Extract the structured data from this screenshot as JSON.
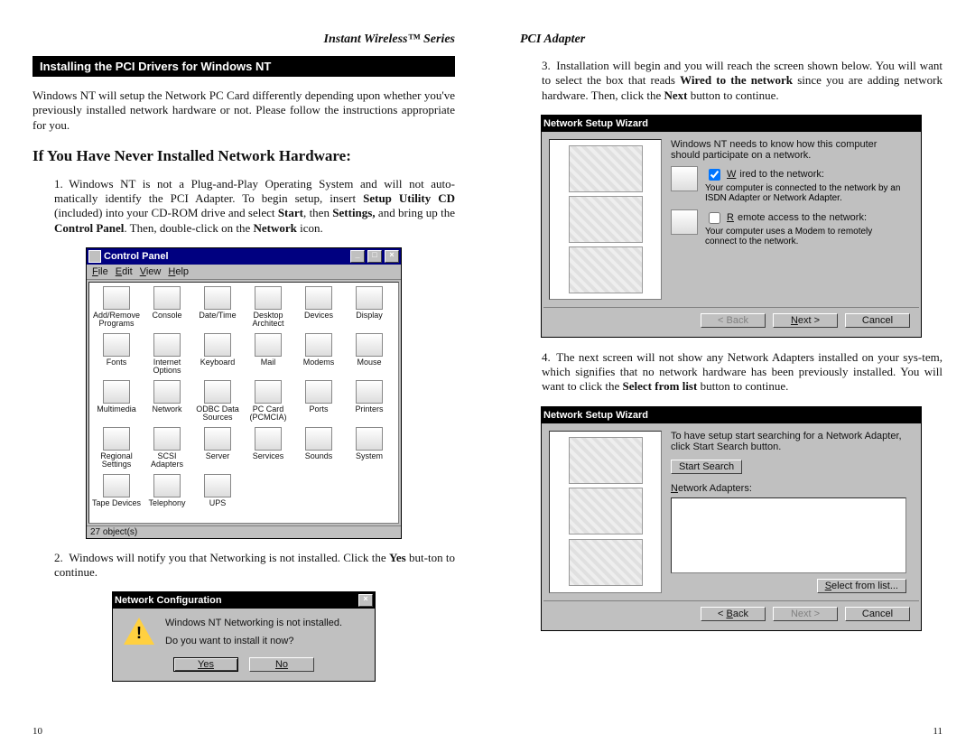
{
  "left": {
    "header": "Instant Wireless™ Series",
    "section_bar": "Installing the PCI Drivers for Windows NT",
    "intro": "Windows NT will setup the Network PC Card differently depending upon whether you've previously installed network hardware or not. Please follow the instructions appropriate for you.",
    "subhead": "If You Have Never Installed Network Hardware:",
    "step1a": "1. Windows NT is not a Plug-and-Play Operating System and will not auto-matically identify the PCI Adapter. To begin setup, insert ",
    "step1b": "Setup Utility CD",
    "step1c": " (included) into your CD-ROM drive and select ",
    "step1d": "Start",
    "step1e": ", then ",
    "step1f": "Settings,",
    "step1g": " and bring up the ",
    "step1h": "Control Panel",
    "step1i": ". Then, double-click on the ",
    "step1j": "Network",
    "step1k": " icon.",
    "step2a": "2. Windows will notify you that Networking is not installed. Click the ",
    "step2b": "Yes",
    "step2c": " but-ton to continue.",
    "pagenum": "10",
    "control_panel": {
      "title": "Control Panel",
      "menu": {
        "file": "File",
        "edit": "Edit",
        "view": "View",
        "help": "Help"
      },
      "items": [
        "Add/Remove Programs",
        "Console",
        "Date/Time",
        "Desktop Architect",
        "Devices",
        "Display",
        "Fonts",
        "Internet Options",
        "Keyboard",
        "Mail",
        "Modems",
        "Mouse",
        "Multimedia",
        "Network",
        "ODBC Data Sources",
        "PC Card (PCMCIA)",
        "Ports",
        "Printers",
        "Regional Settings",
        "SCSI Adapters",
        "Server",
        "Services",
        "Sounds",
        "System",
        "Tape Devices",
        "Telephony",
        "UPS"
      ],
      "status": "27 object(s)"
    },
    "netcfg": {
      "title": "Network Configuration",
      "line1": "Windows NT Networking is not installed.",
      "line2": "Do you want to install it now?",
      "yes": "Yes",
      "no": "No"
    }
  },
  "right": {
    "header": "PCI Adapter",
    "step3a": "3. Installation will begin and you will reach the screen shown below. You will want to select the box that reads ",
    "step3b": "Wired to the network",
    "step3c": " since you are adding network hardware. Then, click the ",
    "step3d": "Next",
    "step3e": " button to continue.",
    "step4a": "4. The next screen will not show any Network Adapters installed on your sys-tem, which signifies that no network hardware has been previously installed. You will want to click the ",
    "step4b": "Select from list",
    "step4c": " button to continue.",
    "pagenum": "11",
    "wiz1": {
      "title": "Network Setup Wizard",
      "intro": "Windows NT needs to know how this computer should participate on a network.",
      "opt1_label": "Wired to the network:",
      "opt1_desc": "Your computer is connected to the network by an ISDN Adapter or Network Adapter.",
      "opt2_label": "Remote access to the network:",
      "opt2_desc": "Your computer uses a Modem to remotely connect to the network.",
      "back": "< Back",
      "next": "Next >",
      "cancel": "Cancel"
    },
    "wiz2": {
      "title": "Network Setup Wizard",
      "intro": "To have setup start searching for a Network Adapter, click Start Search button.",
      "start": "Start Search",
      "adapters_label": "Network Adapters:",
      "select": "Select from list...",
      "back": "< Back",
      "next": "Next >",
      "cancel": "Cancel"
    }
  }
}
